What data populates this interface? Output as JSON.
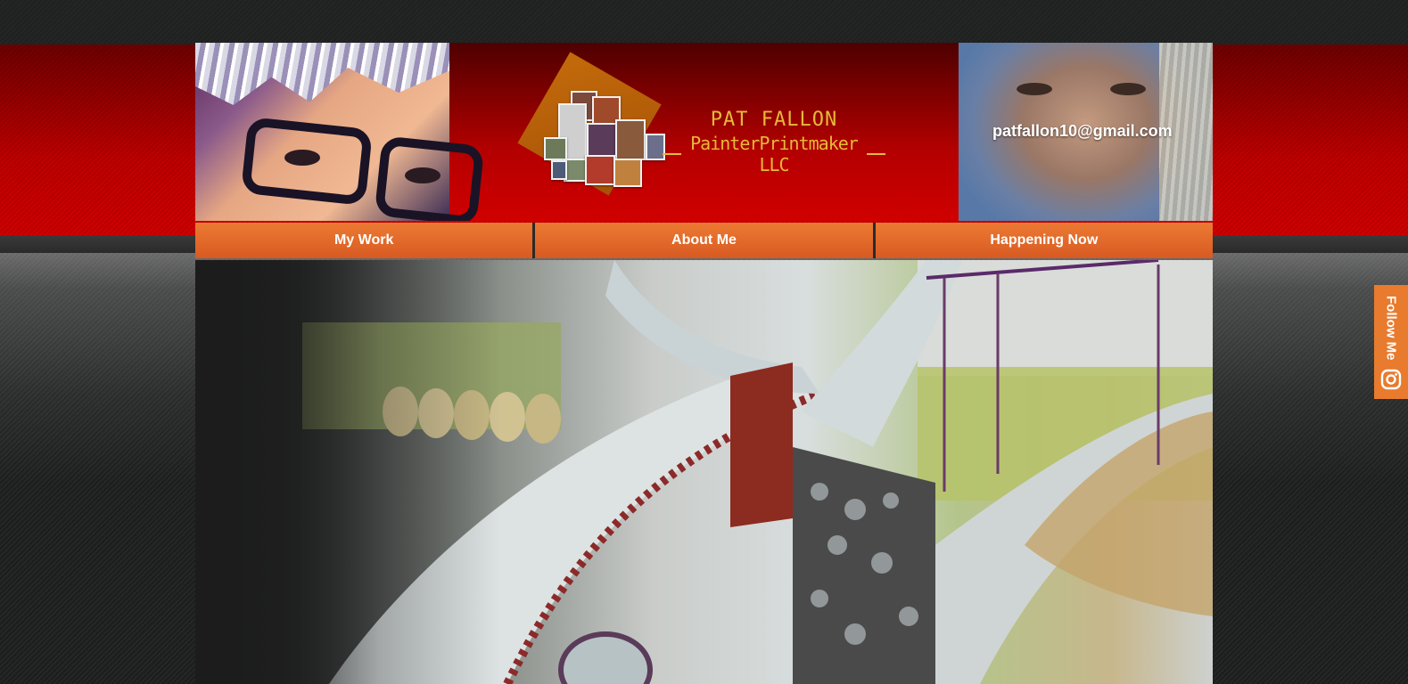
{
  "header": {
    "logo": {
      "name": "PAT FALLON",
      "subtitle": "PainterPrintmaker LLC"
    },
    "email": "patfallon10@gmail.com"
  },
  "nav": {
    "items": [
      {
        "label": "My Work"
      },
      {
        "label": "About Me"
      },
      {
        "label": "Happening Now"
      }
    ]
  },
  "follow": {
    "label": "Follow Me",
    "icon": "instagram-icon"
  },
  "colors": {
    "nav_orange": "#e36a2a",
    "header_red": "#c00000",
    "logo_gold": "#e7b83a",
    "follow_orange": "#e87b2e"
  }
}
